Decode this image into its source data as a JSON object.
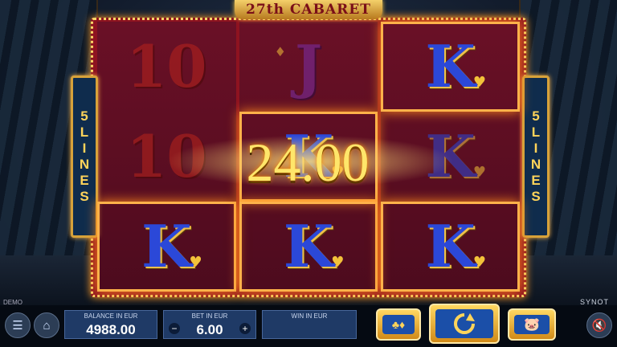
{
  "game": {
    "title": "27th CABARET",
    "mode": "DEMO",
    "provider": "SYNOT"
  },
  "lines_label": {
    "number": "5",
    "word": [
      "L",
      "I",
      "N",
      "E",
      "S"
    ]
  },
  "reels": [
    [
      {
        "symbol": "10",
        "state": "dim"
      },
      {
        "symbol": "10",
        "state": "dim"
      },
      {
        "symbol": "K",
        "state": "win"
      }
    ],
    [
      {
        "symbol": "J",
        "state": "dim"
      },
      {
        "symbol": "K",
        "state": "win"
      },
      {
        "symbol": "K",
        "state": "win"
      }
    ],
    [
      {
        "symbol": "K",
        "state": "win"
      },
      {
        "symbol": "K",
        "state": "dim"
      },
      {
        "symbol": "K",
        "state": "win"
      }
    ]
  ],
  "win_display": "24.00",
  "bottom": {
    "balance_label": "BALANCE IN EUR",
    "balance_value": "4988.00",
    "bet_label": "BET IN EUR",
    "bet_value": "6.00",
    "bet_minus": "−",
    "bet_plus": "+",
    "win_label": "WIN IN EUR",
    "win_value": ""
  },
  "icons": {
    "menu": "menu-icon",
    "home": "home-icon",
    "cards": "cards-icon",
    "spin": "spin-icon",
    "autoplay": "piggy-bank-icon",
    "sound": "sound-off-icon"
  },
  "colors": {
    "accent_gold": "#ffd45a",
    "panel_blue": "#1f3a66",
    "frame_red": "#8e1320"
  }
}
